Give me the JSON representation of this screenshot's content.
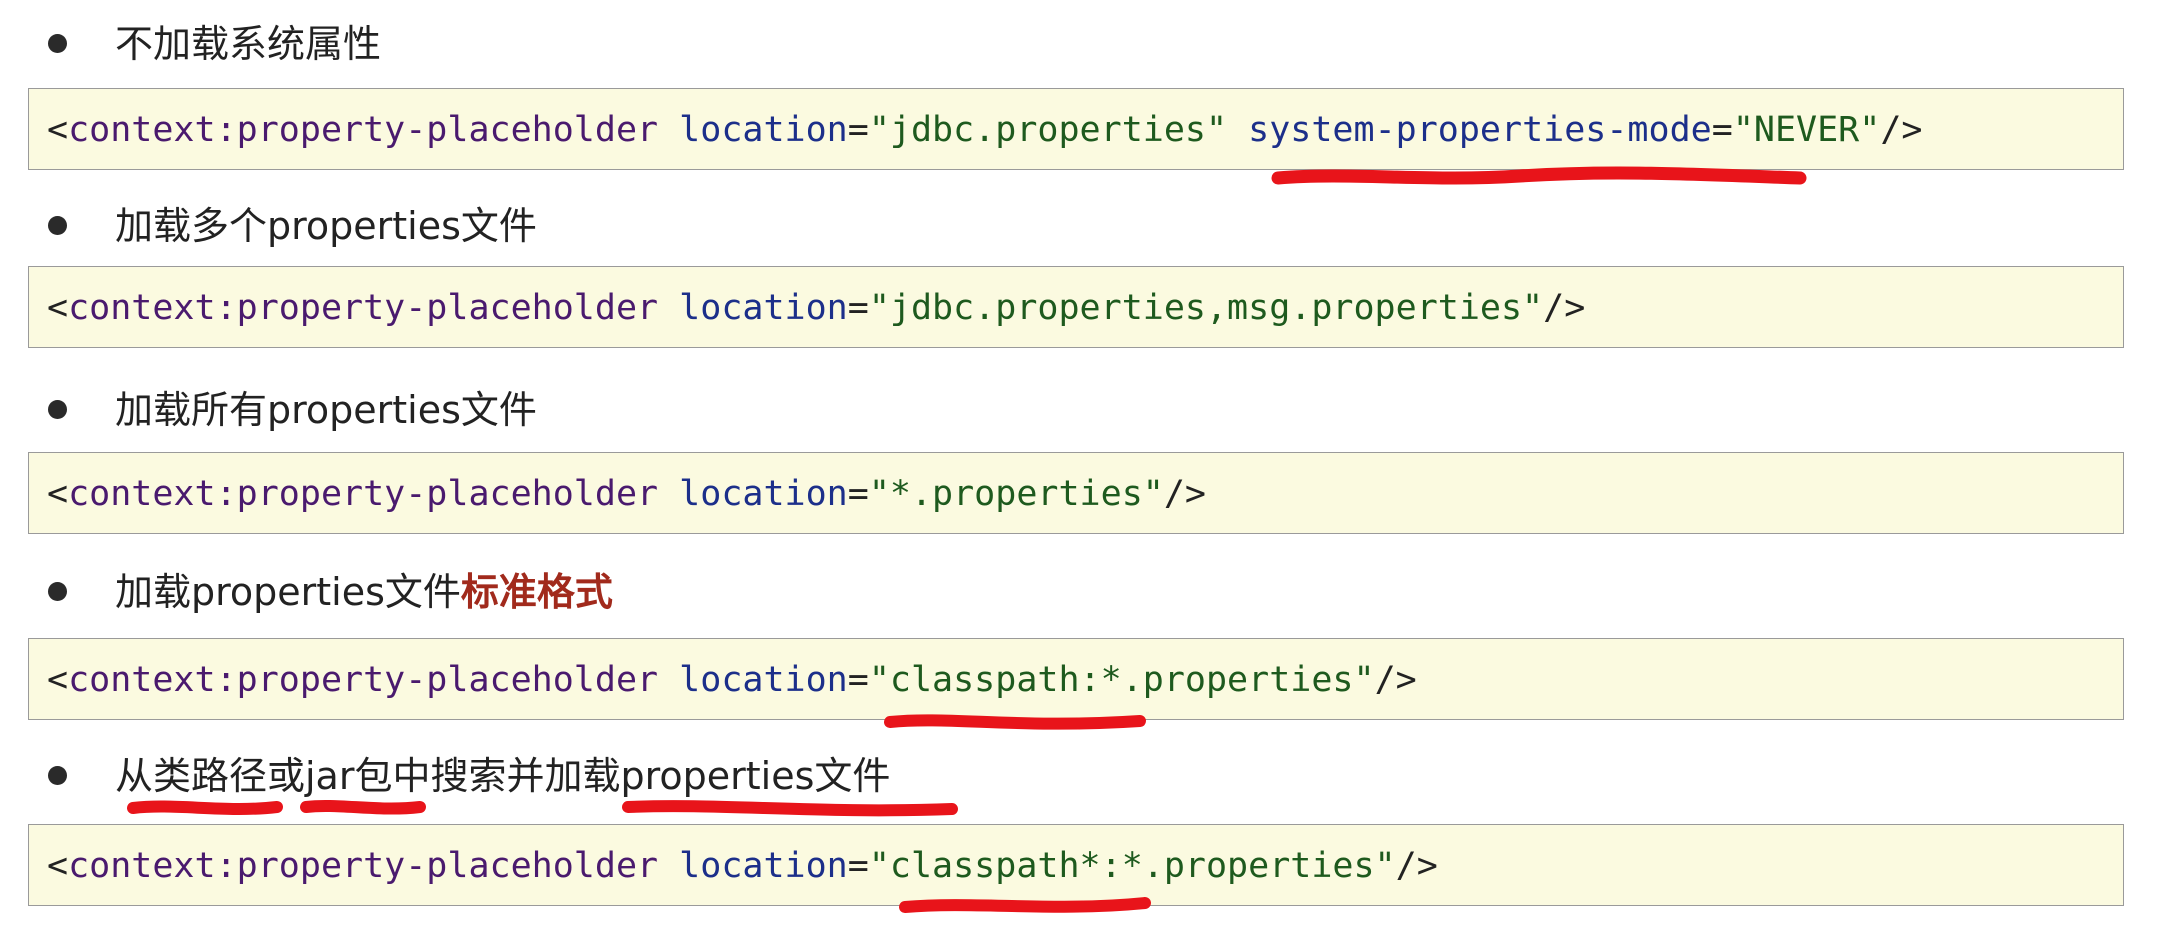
{
  "sections": [
    {
      "bullet": "不加载系统属性",
      "code": {
        "open": "<",
        "tag": "context:property-placeholder",
        "attr1": "location",
        "eq1": "=",
        "val1": "\"jdbc.properties\"",
        "attr2": "system-properties-mode",
        "eq2": "=",
        "val2": "\"NEVER\"",
        "close": "/>"
      }
    },
    {
      "bullet": "加载多个properties文件",
      "code": {
        "open": "<",
        "tag": "context:property-placeholder",
        "attr1": "location",
        "eq1": "=",
        "val1": "\"jdbc.properties,msg.properties\"",
        "close": "/>"
      }
    },
    {
      "bullet": "加载所有properties文件",
      "code": {
        "open": "<",
        "tag": "context:property-placeholder",
        "attr1": "location",
        "eq1": "=",
        "val1": "\"*.properties\"",
        "close": "/>"
      }
    },
    {
      "bullet": "加载properties文件",
      "bullet_highlight": "标准格式",
      "code": {
        "open": "<",
        "tag": "context:property-placeholder",
        "attr1": "location",
        "eq1": "=",
        "val1": "\"classpath:*.properties\"",
        "close": "/>"
      }
    },
    {
      "bullet": "从类路径或jar包中搜索并加载properties文件",
      "code": {
        "open": "<",
        "tag": "context:property-placeholder",
        "attr1": "location",
        "eq1": "=",
        "val1": "\"classpath*:*.properties\"",
        "close": "/>"
      }
    }
  ],
  "colors": {
    "code_background": "#fbfae0",
    "code_border": "#9a9a9a",
    "tag": "#4a1a6e",
    "attribute": "#1c2f8a",
    "string": "#1e5a1e",
    "highlight": "#a12a1c",
    "annotation": "#e8141a"
  },
  "annotations": "red-underline-scribbles"
}
